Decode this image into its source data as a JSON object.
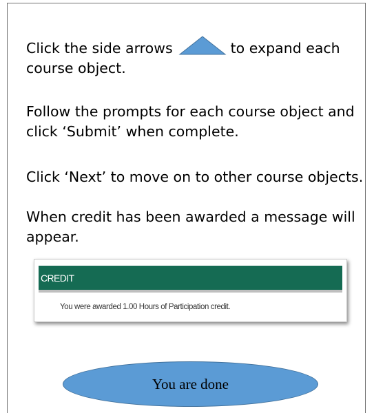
{
  "instructions": {
    "p1_before": "Click the side arrows",
    "p1_after": "to expand each",
    "p1_line2": "course object.",
    "p2": "Follow the prompts for each course object and click ‘Submit’ when complete.",
    "p3": "Click ‘Next’ to move on to other course objects.",
    "p4": "When credit has been awarded a message will appear."
  },
  "arrow_icon": {
    "icon": "triangle-up-icon",
    "fill": "#5b9bd5",
    "stroke": "#41719c"
  },
  "credit_panel": {
    "title": "CREDIT",
    "message": "You were awarded 1.00 Hours of Participation credit.",
    "header_color": "#156b53"
  },
  "done_label": "You are done"
}
